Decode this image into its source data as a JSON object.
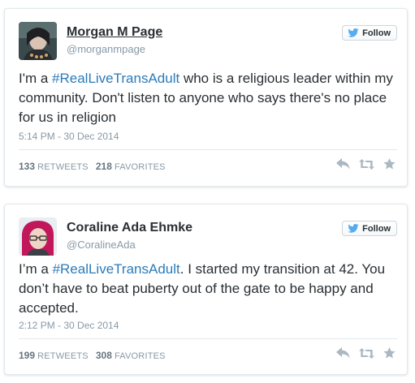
{
  "colors": {
    "accent": "#55acee",
    "link": "#2b7bb9",
    "muted": "#8899a6",
    "text": "#292f33",
    "border": "#e1e8ed"
  },
  "tweets": [
    {
      "name": "Morgan M Page",
      "handle": "@morganmpage",
      "follow_label": "Follow",
      "text_before": "I'm a ",
      "hashtag": "#RealLiveTransAdult",
      "text_after": " who is a religious leader within my community. Don't listen to anyone who says there's no place for us in religion",
      "timestamp": "5:14 PM - 30 Dec 2014",
      "retweets": "133",
      "retweets_label": "RETWEETS",
      "favorites": "218",
      "favorites_label": "FAVORITES",
      "icons": [
        "reply-icon",
        "retweet-icon",
        "favorite-star-icon"
      ]
    },
    {
      "name": "Coraline Ada Ehmke",
      "handle": "@CoralineAda",
      "follow_label": "Follow",
      "text_before": "I’m a ",
      "hashtag": "#RealLiveTransAdult",
      "text_after": ". I started my transition at 42. You don’t have to beat puberty out of the gate to be happy and accepted.",
      "timestamp": "2:12 PM - 30 Dec 2014",
      "retweets": "199",
      "retweets_label": "RETWEETS",
      "favorites": "308",
      "favorites_label": "FAVORITES",
      "icons": [
        "reply-icon",
        "retweet-icon",
        "favorite-star-icon"
      ]
    }
  ]
}
